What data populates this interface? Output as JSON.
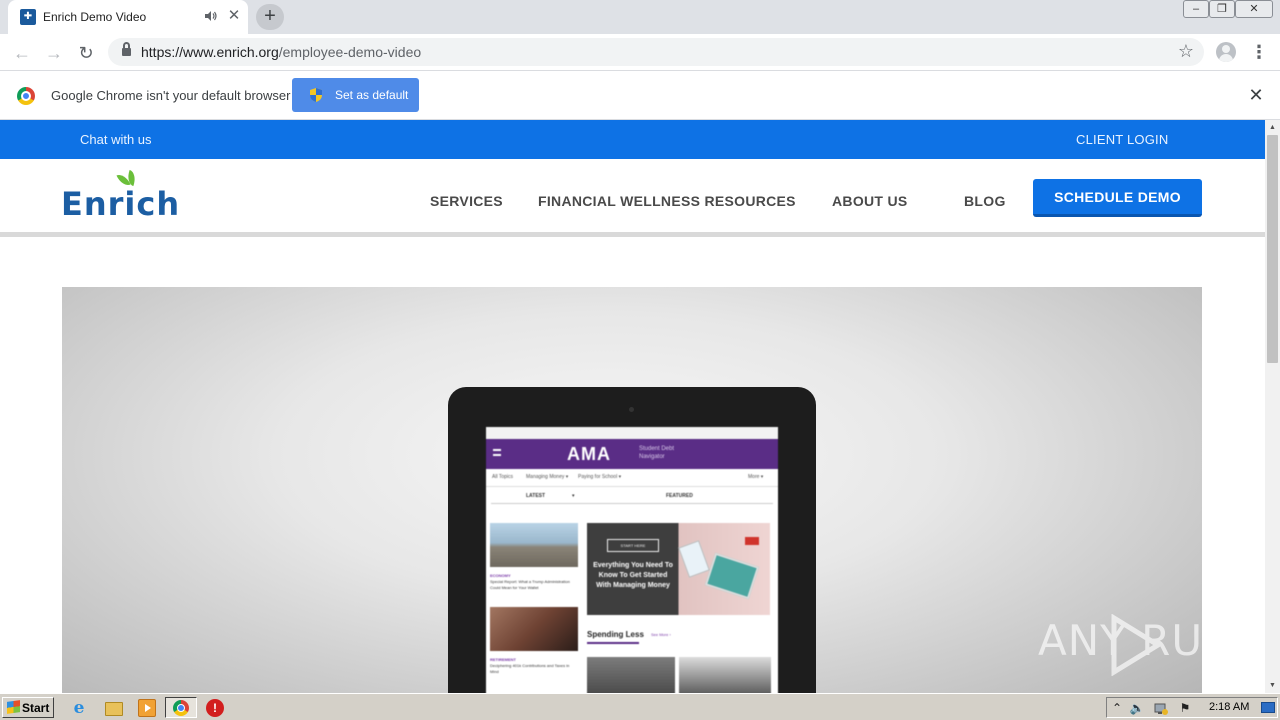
{
  "browser": {
    "tab": {
      "title": "Enrich Demo Video",
      "favicon": "enrich-favicon",
      "audio_icon": "speaker-icon",
      "close_glyph": "✕"
    },
    "new_tab_glyph": "+",
    "window_controls": {
      "minimize": "–",
      "restore": "❐",
      "close": "✕"
    },
    "nav": {
      "back_glyph": "←",
      "forward_glyph": "→",
      "reload_glyph": "↻"
    },
    "url": {
      "host": "https://www.enrich.org",
      "path": "/employee-demo-video"
    },
    "star_glyph": "☆",
    "menu_glyph": "⋮"
  },
  "infobar": {
    "message": "Google Chrome isn't your default browser",
    "button_label": "Set as default",
    "close_glyph": "✕"
  },
  "site": {
    "topbar": {
      "chat_label": "Chat with us",
      "login_label": "CLIENT LOGIN",
      "color": "#0e72e5"
    },
    "logo_text": "Enrich",
    "nav": [
      {
        "label": "SERVICES"
      },
      {
        "label": "FINANCIAL WELLNESS RESOURCES"
      },
      {
        "label": "ABOUT US"
      },
      {
        "label": "BLOG"
      }
    ],
    "cta_label": "SCHEDULE DEMO",
    "video": {
      "screen": {
        "brand": "AMA",
        "brand_sub_line1": "Student Debt",
        "brand_sub_line2": "Navigator",
        "tabs": [
          "All Topics",
          "Managing Money ▾",
          "Paying for School ▾",
          "More ▾"
        ],
        "latest_label": "LATEST",
        "latest_caret": "▾",
        "featured_label": "FEATURED",
        "start_here": "START HERE",
        "feature_title": "Everything You Need To Know To Get Started With Managing Money",
        "story1_category": "ECONOMY",
        "story1_title": "Special Report: What a Trump Administration Could Mean for Your Wallet",
        "story2_category": "RETIREMENT",
        "story2_title": "Deciphering 401k Contributions and Taxes in Mind",
        "spending_label": "Spending Less",
        "see_more": "See More ›"
      }
    },
    "watermark": "ANY RUN"
  },
  "scrollbar": {
    "up_glyph": "▲",
    "down_glyph": "▼"
  },
  "taskbar": {
    "start_label": "Start",
    "ie_glyph": "e",
    "red_app_glyph": "!",
    "tray": {
      "expand_glyph": "⌃",
      "volume_glyph": "🔈",
      "flag_glyph": "⚑",
      "time": "2:18 AM"
    }
  },
  "colors": {
    "accent_blue": "#0e72e5",
    "logo_blue": "#1c5ea3",
    "logo_green": "#6bbf3a",
    "infobar_button": "#4f8be8"
  }
}
